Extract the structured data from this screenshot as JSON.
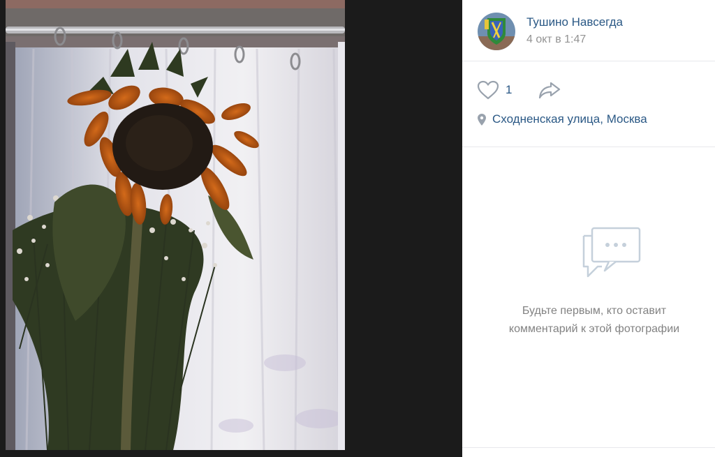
{
  "post": {
    "author": "Тушино Навсегда",
    "date": "4 окт в 1:47"
  },
  "actions": {
    "likes": "1",
    "location": "Сходненская улица, Москва"
  },
  "comments": {
    "empty_line1": "Будьте первым, кто оставит",
    "empty_line2": "комментарий к этой фотографии"
  },
  "icons": {
    "like": "heart-outline-icon",
    "share": "share-arrow-icon",
    "location": "map-pin-icon",
    "comments": "chat-bubbles-icon"
  },
  "colors": {
    "link": "#2a5885",
    "icon": "#99a2ad",
    "muted": "#828282",
    "divider": "#e7e8ec",
    "viewer_bg": "#1b1b1b"
  }
}
